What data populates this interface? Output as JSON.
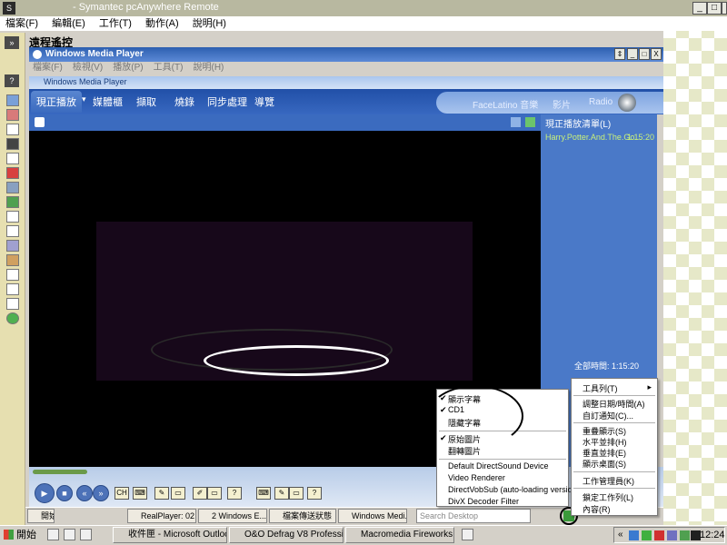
{
  "pca": {
    "title": "- Symantec pcAnywhere Remote",
    "menu": [
      "檔案(F)",
      "編輯(E)",
      "工作(T)",
      "動作(A)",
      "說明(H)"
    ],
    "remote_label": "遠程遙控",
    "window_buttons": [
      "_",
      "□",
      "X"
    ]
  },
  "wmp_outer": {
    "title": "Windows Media Player",
    "menu": [
      "檔案(F)",
      "檢視(V)",
      "播放(P)",
      "工具(T)",
      "說明(H)"
    ]
  },
  "wmp": {
    "title": "Windows Media Player",
    "tabs": [
      "現正播放",
      "媒體櫃",
      "擷取",
      "燒錄",
      "同步處理",
      "導覽"
    ],
    "right_tabs": [
      "FaceLatino 音樂",
      "影片",
      "Radio"
    ],
    "playlist_header": "現正播放清單(L)",
    "playlist_item": "Harry.Potter.And.The.Go...",
    "playlist_item_duration": "1:15:20",
    "total_time": "全部時間: 1:15:20"
  },
  "remote_bar": {
    "buttons": [
      "RealPlayer: 02 ...",
      "2 Windows E...",
      "檔案傳送狀態",
      "Windows Medi..."
    ],
    "search_placeholder": "Search Desktop"
  },
  "left_menu": {
    "items": [
      "顯示字幕",
      "CD1",
      "隱藏字幕",
      "原始圖片",
      "翻轉圖片",
      "Default DirectSound Device",
      "Video Renderer",
      "DirectVobSub (auto-loading version)",
      "DivX Decoder Filter"
    ],
    "checked": [
      true,
      true,
      false,
      true,
      false,
      false,
      false,
      false,
      false
    ]
  },
  "right_menu": {
    "items": [
      "工具列(T)",
      "調整日期/時間(A)",
      "自訂通知(C)...",
      "重疊顯示(S)",
      "水平並排(H)",
      "垂直並排(E)",
      "顯示桌面(S)",
      "工作管理員(K)",
      "鎖定工作列(L)",
      "內容(R)"
    ]
  },
  "taskbar": {
    "start": "開始",
    "buttons": [
      "收件匣 - Microsoft Outlook",
      "O&O Defrag V8 Professio...",
      "Macromedia Fireworks M..."
    ],
    "clock": "12:24"
  },
  "colors": {
    "wmp_blue": "#2150a8",
    "playlist_green": "#c8f07a",
    "pca_toolbar": "#e6dfb0"
  }
}
